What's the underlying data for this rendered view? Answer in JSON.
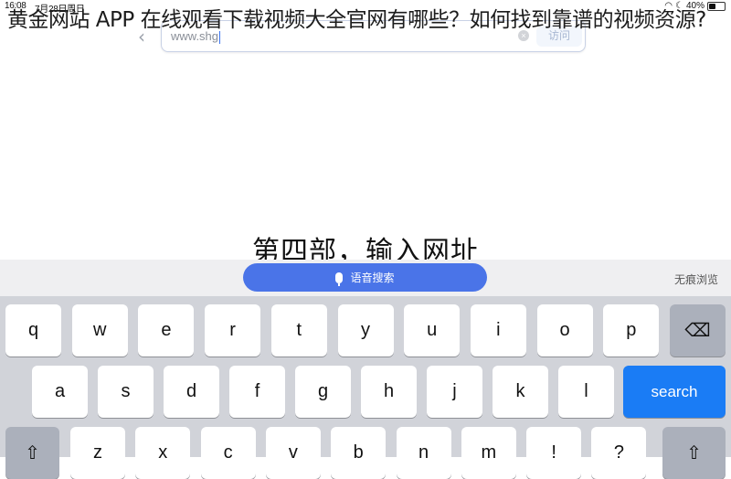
{
  "status_bar": {
    "time": "16:08",
    "date": "7月28日周日",
    "battery": "40%",
    "battery_level": 0.4
  },
  "overlay_title": "黄金网站 APP 在线观看下载视频大全官网有哪些？如何找到靠谱的视频资源?",
  "browser": {
    "back_icon": "‹",
    "url_value": "www.shg",
    "clear_icon": "×",
    "visit_label": "访问"
  },
  "caption": "第四部，输入网址",
  "accessory_bar": {
    "voice_search_label": "语音搜索",
    "incognito_label": "无痕浏览"
  },
  "keyboard": {
    "row1": [
      "q",
      "w",
      "e",
      "r",
      "t",
      "y",
      "u",
      "i",
      "o",
      "p"
    ],
    "row2": [
      "a",
      "s",
      "d",
      "f",
      "g",
      "h",
      "j",
      "k",
      "l"
    ],
    "row3": [
      "z",
      "x",
      "c",
      "v",
      "b",
      "n",
      "m",
      "!",
      "?"
    ],
    "backspace_icon": "⌫",
    "search_label": "search",
    "shift_icon": "⇧",
    "colors": {
      "search": "#1a7cf5",
      "voice": "#4a74e8"
    }
  }
}
